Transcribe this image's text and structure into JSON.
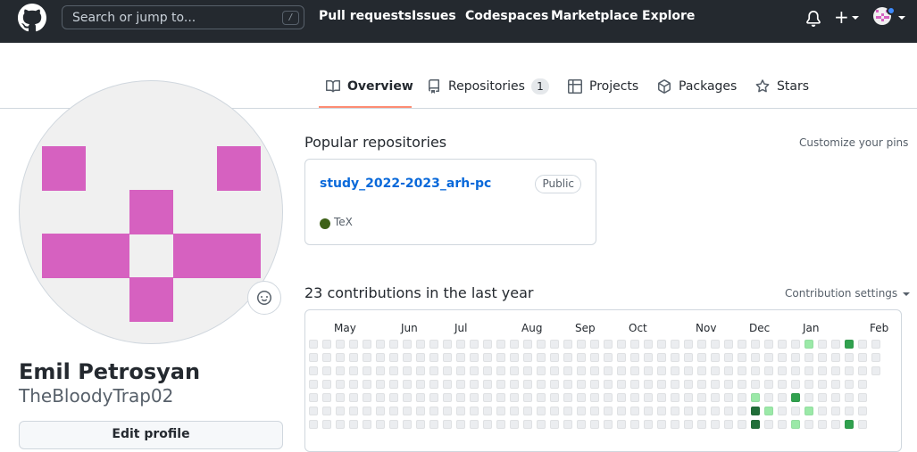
{
  "header": {
    "search_placeholder": "Search or jump to...",
    "search_shortcut": "/",
    "nav": [
      "Pull requests",
      "Issues",
      "Codespaces",
      "Marketplace",
      "Explore"
    ],
    "icons": [
      "github-logo",
      "bell-icon",
      "plus-icon",
      "avatar"
    ]
  },
  "tabs": [
    {
      "label": "Overview",
      "icon": "book-icon",
      "active": true
    },
    {
      "label": "Repositories",
      "icon": "repo-icon",
      "count": "1"
    },
    {
      "label": "Projects",
      "icon": "table-icon"
    },
    {
      "label": "Packages",
      "icon": "package-icon"
    },
    {
      "label": "Stars",
      "icon": "star-icon"
    }
  ],
  "profile": {
    "name": "Emil Petrosyan",
    "username": "TheBloodyTrap02",
    "edit_label": "Edit profile",
    "identicon_color": "#d661c0"
  },
  "popular": {
    "title": "Popular repositories",
    "customize": "Customize your pins",
    "repos": [
      {
        "name": "study_2022-2023_arh-pc",
        "visibility": "Public",
        "language": "TeX",
        "language_color": "#3d6117"
      }
    ]
  },
  "contributions": {
    "title": "23 contributions in the last year",
    "settings": "Contribution settings",
    "months": [
      "May",
      "Jun",
      "Jul",
      "Aug",
      "Sep",
      "Oct",
      "Nov",
      "Dec",
      "Jan",
      "Feb"
    ],
    "level_colors": [
      "#ebedf0",
      "#9be9a8",
      "#40c463",
      "#30a14e",
      "#216e39"
    ],
    "active_cells": [
      {
        "week": 33,
        "day": 4,
        "level": 1
      },
      {
        "week": 33,
        "day": 5,
        "level": 4
      },
      {
        "week": 33,
        "day": 6,
        "level": 4
      },
      {
        "week": 34,
        "day": 5,
        "level": 1
      },
      {
        "week": 36,
        "day": 4,
        "level": 3
      },
      {
        "week": 36,
        "day": 6,
        "level": 1
      },
      {
        "week": 37,
        "day": 0,
        "level": 1
      },
      {
        "week": 37,
        "day": 5,
        "level": 1
      },
      {
        "week": 40,
        "day": 0,
        "level": 3
      },
      {
        "week": 40,
        "day": 6,
        "level": 3
      }
    ]
  }
}
